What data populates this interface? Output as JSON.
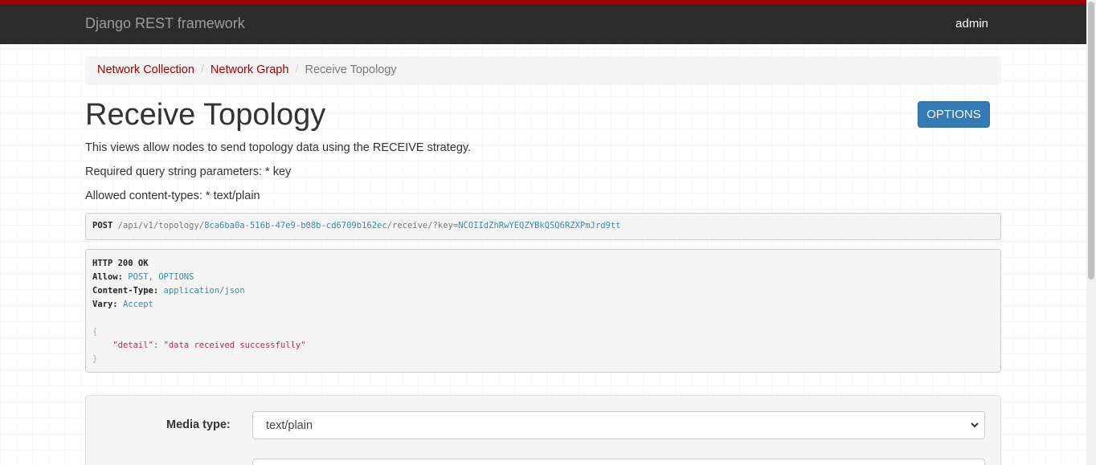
{
  "navbar": {
    "brand": "Django REST framework",
    "user": "admin"
  },
  "breadcrumb": {
    "items": [
      "Network Collection",
      "Network Graph"
    ],
    "active": "Receive Topology"
  },
  "page": {
    "title": "Receive Topology",
    "options_label": "OPTIONS",
    "description_lines": [
      "This views allow nodes to send topology data using the RECEIVE strategy.",
      "Required query string parameters: * key",
      "Allowed content-types: * text/plain"
    ]
  },
  "request": {
    "method": "POST",
    "path_prefix": "/api/v1/topology/",
    "uuid": "8ca6ba0a-516b-47e9-b08b-cd6709b162ec",
    "path_suffix": "/receive/?key=",
    "key_value": "NCOIIdZhRwYEQZYBkQSQ6RZXPmJrd9tt"
  },
  "response": {
    "status": "HTTP 200 OK",
    "headers": [
      {
        "key": "Allow:",
        "value": "POST, OPTIONS"
      },
      {
        "key": "Content-Type:",
        "value": "application/json"
      },
      {
        "key": "Vary:",
        "value": "Accept"
      }
    ],
    "body_open": "{",
    "body_key": "\"detail\"",
    "body_colon": ": ",
    "body_value": "\"data received successfully\"",
    "body_close": "}"
  },
  "form": {
    "media_type_label": "Media type:",
    "media_type_value": "text/plain"
  },
  "colors": {
    "accent_red": "#a30000",
    "navbar_bg": "#2c2c2c",
    "primary_button": "#337ab7",
    "link_teal": "#3a8aa8",
    "json_string": "#c7254e"
  }
}
